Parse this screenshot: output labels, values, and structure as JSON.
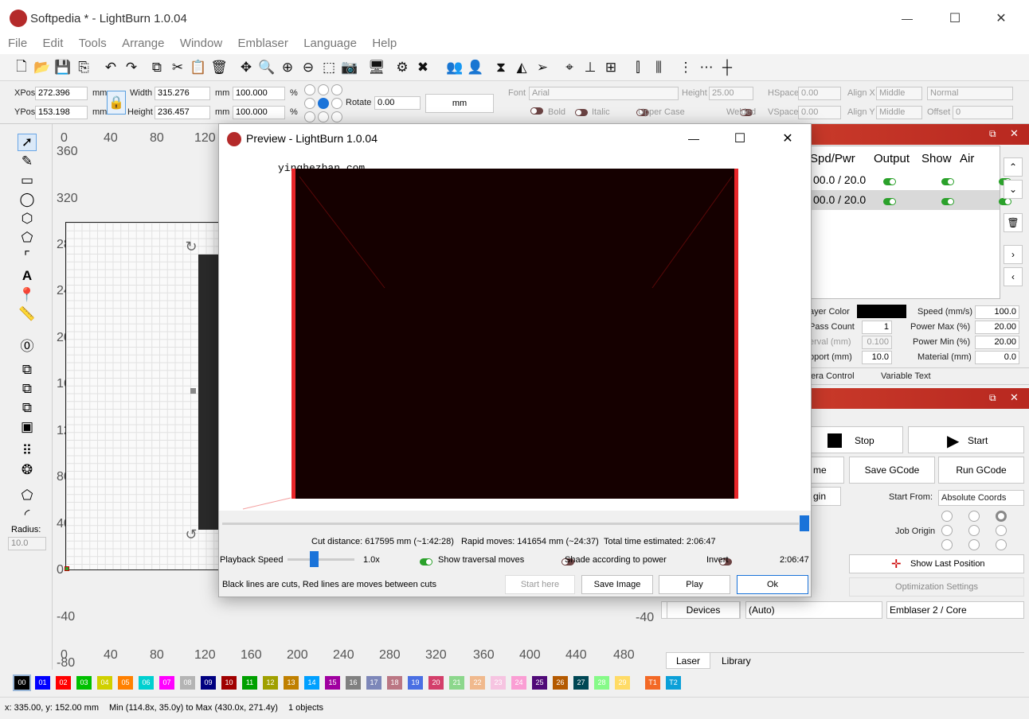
{
  "window": {
    "title": "Softpedia * - LightBurn 1.0.04",
    "minimize": "—",
    "maximize": "☐",
    "close": "✕"
  },
  "menu": [
    "File",
    "Edit",
    "Tools",
    "Arrange",
    "Window",
    "Emblaser",
    "Language",
    "Help"
  ],
  "props": {
    "xpos_label": "XPos",
    "xpos": "272.396",
    "ypos_label": "YPos",
    "ypos": "153.198",
    "unit": "mm",
    "width_label": "Width",
    "width": "315.276",
    "height_label": "Height",
    "height": "236.457",
    "pct": "%",
    "scale_w": "100.000",
    "scale_h": "100.000",
    "rotate_label": "Rotate",
    "rotate": "0.00",
    "unit_button": "mm",
    "font_label": "Font",
    "font": "Arial",
    "text_height_label": "Height",
    "text_height": "25.00",
    "hspace_label": "HSpace",
    "hspace": "0.00",
    "vspace_label": "VSpace",
    "vspace": "0.00",
    "alignx_label": "Align X",
    "alignx": "Middle",
    "aligny_label": "Align Y",
    "aligny": "Middle",
    "style": "Normal",
    "offset_label": "Offset",
    "offset": "0",
    "bold": "Bold",
    "italic": "Italic",
    "upper": "Upper Case",
    "welded": "Welded"
  },
  "ruler": {
    "top": [
      "0",
      "40",
      "80",
      "120"
    ],
    "left": [
      "360",
      "320",
      "280",
      "240",
      "200",
      "160",
      "120",
      "80",
      "40",
      "0",
      "-40",
      "-80"
    ],
    "bottom": [
      "0",
      "40",
      "80",
      "120",
      "160",
      "200",
      "240",
      "280",
      "320",
      "360",
      "400",
      "440",
      "480"
    ],
    "right_neg": "-40"
  },
  "radius": {
    "label": "Radius:",
    "value": "10.0"
  },
  "cuts": {
    "headers": [
      "Spd/Pwr",
      "Output",
      "Show",
      "Air"
    ],
    "rows": [
      {
        "spd": "00.0 / 20.0"
      },
      {
        "spd": "00.0 / 20.0"
      }
    ]
  },
  "layer": {
    "color_label": "ayer Color",
    "pass_label": "Pass Count",
    "pass": "1",
    "interval_label": "erval (mm)",
    "interval": "0.100",
    "overscan_label": "pport (mm)",
    "overscan": "10.0",
    "speed_label": "Speed (mm/s)",
    "speed": "100.0",
    "pmax_label": "Power Max (%)",
    "pmax": "20.00",
    "pmin_label": "Power Min (%)",
    "pmin": "20.00",
    "material_label": "Material (mm)",
    "material": "0.0"
  },
  "tabs_mid": [
    "nera Control",
    "Variable Text"
  ],
  "laser": {
    "stop": "Stop",
    "start": "Start",
    "frame": "me",
    "save_gcode": "Save GCode",
    "run_gcode": "Run GCode",
    "origin": "gin",
    "start_from_label": "Start From:",
    "start_from": "Absolute Coords",
    "job_origin": "Job Origin",
    "show_last": "Show Last Position",
    "opt": "Optimization Settings",
    "devices": "Devices",
    "auto": "(Auto)",
    "device": "Emblaser 2 / Core"
  },
  "bottom_tabs": [
    "Laser",
    "Library"
  ],
  "palette": [
    {
      "n": "00",
      "c": "#000000"
    },
    {
      "n": "01",
      "c": "#0000ff"
    },
    {
      "n": "02",
      "c": "#ff0000"
    },
    {
      "n": "03",
      "c": "#00c000"
    },
    {
      "n": "04",
      "c": "#d0d000"
    },
    {
      "n": "05",
      "c": "#ff8000"
    },
    {
      "n": "06",
      "c": "#00d0d0"
    },
    {
      "n": "07",
      "c": "#ff00ff"
    },
    {
      "n": "08",
      "c": "#b4b4b4"
    },
    {
      "n": "09",
      "c": "#000080"
    },
    {
      "n": "10",
      "c": "#a00000"
    },
    {
      "n": "11",
      "c": "#00a000"
    },
    {
      "n": "12",
      "c": "#a0a000"
    },
    {
      "n": "13",
      "c": "#c08000"
    },
    {
      "n": "14",
      "c": "#00a0ff"
    },
    {
      "n": "15",
      "c": "#a000a0"
    },
    {
      "n": "16",
      "c": "#808080"
    },
    {
      "n": "17",
      "c": "#7d87b9"
    },
    {
      "n": "18",
      "c": "#bb7784"
    },
    {
      "n": "19",
      "c": "#4a6fe3"
    },
    {
      "n": "20",
      "c": "#d33f6a"
    },
    {
      "n": "21",
      "c": "#8cd78c"
    },
    {
      "n": "22",
      "c": "#f0b98d"
    },
    {
      "n": "23",
      "c": "#f6c4e1"
    },
    {
      "n": "24",
      "c": "#fa9ed4"
    },
    {
      "n": "25",
      "c": "#500a78"
    },
    {
      "n": "26",
      "c": "#b45a00"
    },
    {
      "n": "27",
      "c": "#004754"
    },
    {
      "n": "28",
      "c": "#86fa88"
    },
    {
      "n": "29",
      "c": "#ffdb66"
    },
    {
      "n": "T1",
      "c": "#f36926"
    },
    {
      "n": "T2",
      "c": "#0ca0d8"
    }
  ],
  "status": {
    "coords": "x: 335.00, y: 152.00 mm",
    "range": "Min (114.8x, 35.0y) to Max (430.0x, 271.4y)",
    "objects": "1 objects"
  },
  "preview": {
    "title": "Preview - LightBurn 1.0.04",
    "watermark": "yinghezhan.com",
    "cut": "Cut distance: 617595 mm (~1:42:28)",
    "rapid": "Rapid moves: 141654 mm (~24:37)",
    "total": "Total time estimated: 2:06:47",
    "playback": "Playback Speed",
    "speed": "1.0x",
    "traversal": "Show traversal moves",
    "shade": "Shade according to power",
    "invert": "Invert",
    "time": "2:06:47",
    "hint": "Black lines are cuts, Red lines are moves between cuts",
    "start_here": "Start here",
    "save_image": "Save Image",
    "play": "Play",
    "ok": "Ok"
  }
}
